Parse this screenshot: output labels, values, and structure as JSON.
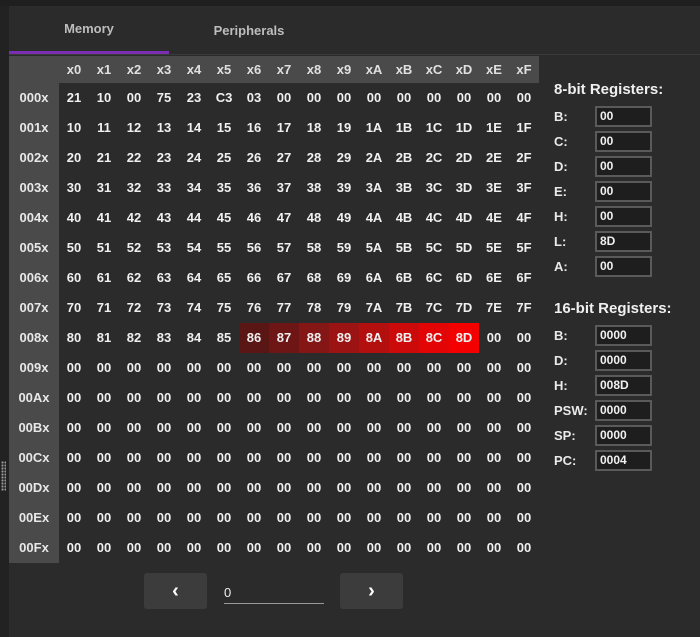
{
  "tabs": [
    {
      "label": "Memory",
      "active": true
    },
    {
      "label": "Peripherals",
      "active": false
    }
  ],
  "memory": {
    "col_headers": [
      "x0",
      "x1",
      "x2",
      "x3",
      "x4",
      "x5",
      "x6",
      "x7",
      "x8",
      "x9",
      "xA",
      "xB",
      "xC",
      "xD",
      "xE",
      "xF"
    ],
    "rows": [
      {
        "label": "000x",
        "cells": [
          "21",
          "10",
          "00",
          "75",
          "23",
          "C3",
          "03",
          "00",
          "00",
          "00",
          "00",
          "00",
          "00",
          "00",
          "00",
          "00"
        ]
      },
      {
        "label": "001x",
        "cells": [
          "10",
          "11",
          "12",
          "13",
          "14",
          "15",
          "16",
          "17",
          "18",
          "19",
          "1A",
          "1B",
          "1C",
          "1D",
          "1E",
          "1F"
        ]
      },
      {
        "label": "002x",
        "cells": [
          "20",
          "21",
          "22",
          "23",
          "24",
          "25",
          "26",
          "27",
          "28",
          "29",
          "2A",
          "2B",
          "2C",
          "2D",
          "2E",
          "2F"
        ]
      },
      {
        "label": "003x",
        "cells": [
          "30",
          "31",
          "32",
          "33",
          "34",
          "35",
          "36",
          "37",
          "38",
          "39",
          "3A",
          "3B",
          "3C",
          "3D",
          "3E",
          "3F"
        ]
      },
      {
        "label": "004x",
        "cells": [
          "40",
          "41",
          "42",
          "43",
          "44",
          "45",
          "46",
          "47",
          "48",
          "49",
          "4A",
          "4B",
          "4C",
          "4D",
          "4E",
          "4F"
        ]
      },
      {
        "label": "005x",
        "cells": [
          "50",
          "51",
          "52",
          "53",
          "54",
          "55",
          "56",
          "57",
          "58",
          "59",
          "5A",
          "5B",
          "5C",
          "5D",
          "5E",
          "5F"
        ]
      },
      {
        "label": "006x",
        "cells": [
          "60",
          "61",
          "62",
          "63",
          "64",
          "65",
          "66",
          "67",
          "68",
          "69",
          "6A",
          "6B",
          "6C",
          "6D",
          "6E",
          "6F"
        ]
      },
      {
        "label": "007x",
        "cells": [
          "70",
          "71",
          "72",
          "73",
          "74",
          "75",
          "76",
          "77",
          "78",
          "79",
          "7A",
          "7B",
          "7C",
          "7D",
          "7E",
          "7F"
        ]
      },
      {
        "label": "008x",
        "cells": [
          "80",
          "81",
          "82",
          "83",
          "84",
          "85",
          "86",
          "87",
          "88",
          "89",
          "8A",
          "8B",
          "8C",
          "8D",
          "00",
          "00"
        ]
      },
      {
        "label": "009x",
        "cells": [
          "00",
          "00",
          "00",
          "00",
          "00",
          "00",
          "00",
          "00",
          "00",
          "00",
          "00",
          "00",
          "00",
          "00",
          "00",
          "00"
        ]
      },
      {
        "label": "00Ax",
        "cells": [
          "00",
          "00",
          "00",
          "00",
          "00",
          "00",
          "00",
          "00",
          "00",
          "00",
          "00",
          "00",
          "00",
          "00",
          "00",
          "00"
        ]
      },
      {
        "label": "00Bx",
        "cells": [
          "00",
          "00",
          "00",
          "00",
          "00",
          "00",
          "00",
          "00",
          "00",
          "00",
          "00",
          "00",
          "00",
          "00",
          "00",
          "00"
        ]
      },
      {
        "label": "00Cx",
        "cells": [
          "00",
          "00",
          "00",
          "00",
          "00",
          "00",
          "00",
          "00",
          "00",
          "00",
          "00",
          "00",
          "00",
          "00",
          "00",
          "00"
        ]
      },
      {
        "label": "00Dx",
        "cells": [
          "00",
          "00",
          "00",
          "00",
          "00",
          "00",
          "00",
          "00",
          "00",
          "00",
          "00",
          "00",
          "00",
          "00",
          "00",
          "00"
        ]
      },
      {
        "label": "00Ex",
        "cells": [
          "00",
          "00",
          "00",
          "00",
          "00",
          "00",
          "00",
          "00",
          "00",
          "00",
          "00",
          "00",
          "00",
          "00",
          "00",
          "00"
        ]
      },
      {
        "label": "00Fx",
        "cells": [
          "00",
          "00",
          "00",
          "00",
          "00",
          "00",
          "00",
          "00",
          "00",
          "00",
          "00",
          "00",
          "00",
          "00",
          "00",
          "00"
        ]
      }
    ],
    "highlights": [
      {
        "row": 8,
        "col": 6,
        "color": "#5a1515"
      },
      {
        "row": 8,
        "col": 7,
        "color": "#6e1616"
      },
      {
        "row": 8,
        "col": 8,
        "color": "#851616"
      },
      {
        "row": 8,
        "col": 9,
        "color": "#9c1313"
      },
      {
        "row": 8,
        "col": 10,
        "color": "#b40f0f"
      },
      {
        "row": 8,
        "col": 11,
        "color": "#cc0a0a"
      },
      {
        "row": 8,
        "col": 12,
        "color": "#e30505"
      },
      {
        "row": 8,
        "col": 13,
        "color": "#f50000"
      }
    ]
  },
  "registers8": {
    "title": "8-bit Registers:",
    "items": [
      {
        "label": "B:",
        "value": "00"
      },
      {
        "label": "C:",
        "value": "00"
      },
      {
        "label": "D:",
        "value": "00"
      },
      {
        "label": "E:",
        "value": "00"
      },
      {
        "label": "H:",
        "value": "00"
      },
      {
        "label": "L:",
        "value": "8D"
      },
      {
        "label": "A:",
        "value": "00"
      }
    ]
  },
  "registers16": {
    "title": "16-bit Registers:",
    "items": [
      {
        "label": "B:",
        "value": "0000"
      },
      {
        "label": "D:",
        "value": "0000"
      },
      {
        "label": "H:",
        "value": "008D"
      },
      {
        "label": "PSW:",
        "value": "0000"
      },
      {
        "label": "SP:",
        "value": "0000"
      },
      {
        "label": "PC:",
        "value": "0004"
      }
    ]
  },
  "pager": {
    "prev_icon": "chevron-left-icon",
    "next_icon": "chevron-right-icon",
    "page_value": "0"
  }
}
